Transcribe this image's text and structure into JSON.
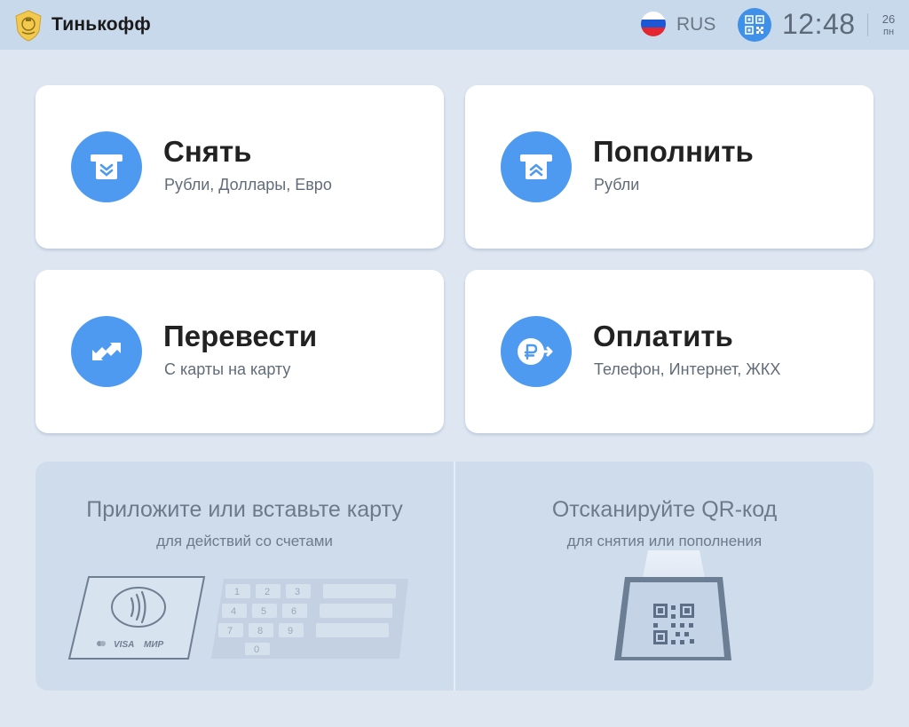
{
  "header": {
    "brand": "Тинькофф",
    "language": "RUS",
    "time": "12:48",
    "date_day": "26",
    "date_weekday": "пн"
  },
  "tiles": {
    "withdraw": {
      "title": "Снять",
      "subtitle": "Рубли, Доллары, Евро",
      "icon": "atm-withdraw-icon"
    },
    "deposit": {
      "title": "Пополнить",
      "subtitle": "Рубли",
      "icon": "atm-deposit-icon"
    },
    "transfer": {
      "title": "Перевести",
      "subtitle": "С карты на карту",
      "icon": "transfer-arrows-icon"
    },
    "pay": {
      "title": "Оплатить",
      "subtitle": "Телефон, Интернет, ЖКХ",
      "icon": "ruble-pay-icon"
    }
  },
  "bottom": {
    "card": {
      "title": "Приложите или вставьте карту",
      "subtitle": "для действий со счетами",
      "card_brands": [
        "VISA",
        "МИР"
      ],
      "keypad_keys": [
        "1",
        "2",
        "3",
        "4",
        "5",
        "6",
        "7",
        "8",
        "9",
        "0"
      ]
    },
    "qr": {
      "title": "Отсканируйте QR-код",
      "subtitle": "для снятия или пополнения"
    }
  },
  "colors": {
    "accent": "#4d9af0",
    "header_bg": "#c9d9ec",
    "page_bg": "#dde6f1",
    "tile_bg": "#ffffff"
  }
}
